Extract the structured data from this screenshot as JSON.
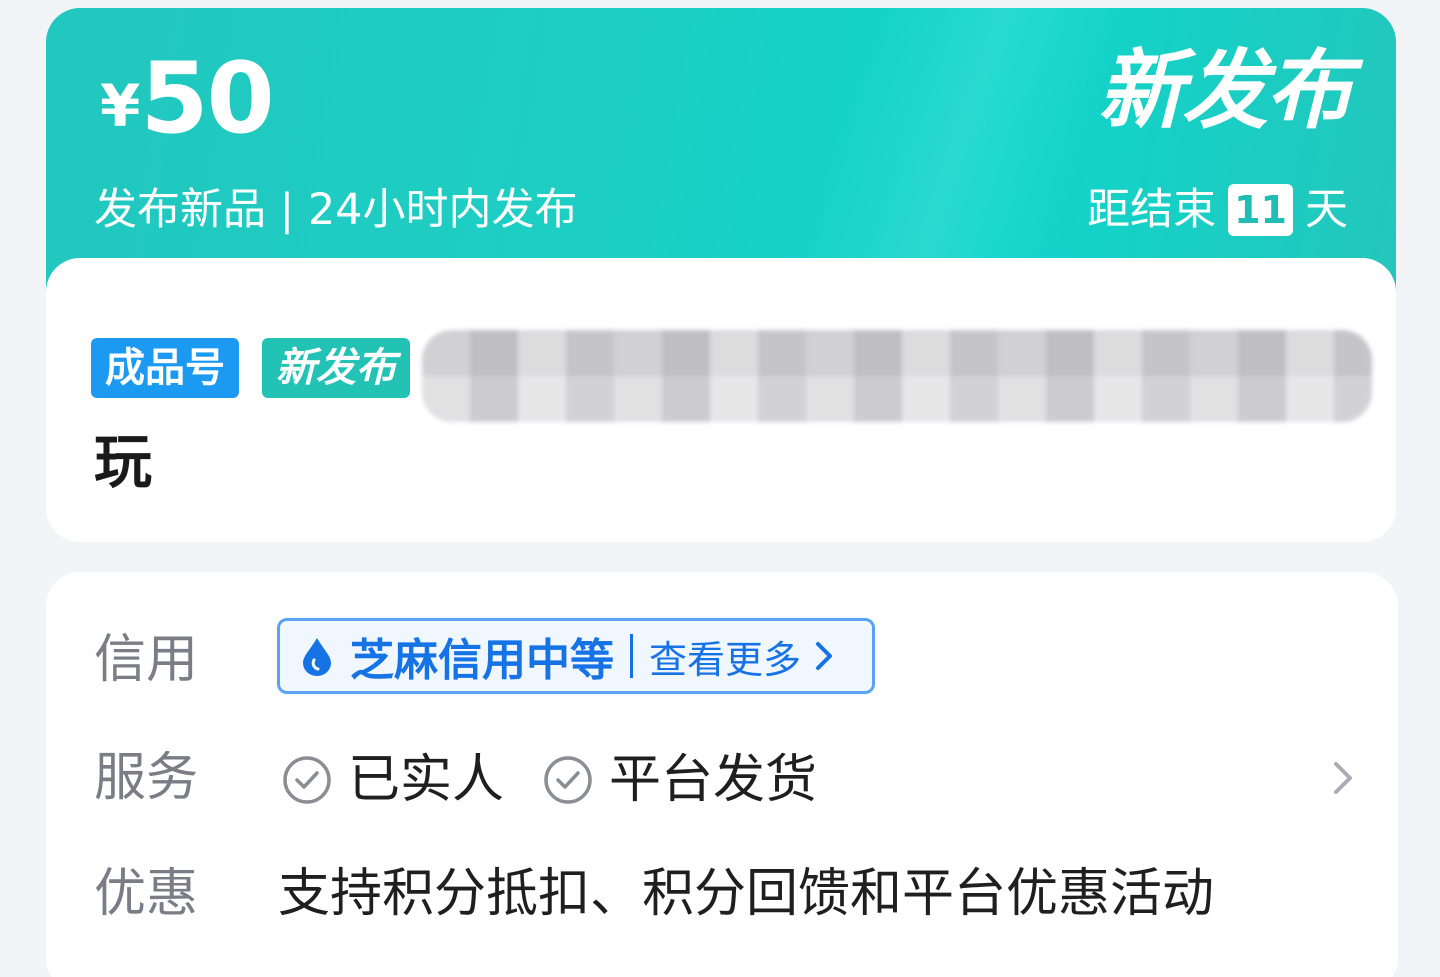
{
  "banner": {
    "currency": "¥",
    "price": "50",
    "subtitle": "发布新品 | 24小时内发布",
    "title": "新发布",
    "countdown_prefix": "距结束",
    "countdown_days": "11",
    "countdown_suffix": "天"
  },
  "product": {
    "tags": [
      "成品号",
      "新发布"
    ],
    "name_line2": "玩"
  },
  "info": {
    "credit": {
      "label": "信用",
      "chip_text": "芝麻信用中等",
      "more_text": "查看更多"
    },
    "service": {
      "label": "服务",
      "items": [
        "已实人",
        "平台发货"
      ]
    },
    "promo": {
      "label": "优惠",
      "text": "支持积分抵扣、积分回馈和平台优惠活动"
    }
  },
  "colors": {
    "banner_teal": "#1ccfc4",
    "tag_blue": "#1c9af2",
    "tag_teal": "#22c2b4",
    "credit_blue": "#1673e6"
  },
  "icons": {
    "credit": "drop-icon",
    "more": "chevron-right-icon",
    "service_check": "check-circle-icon",
    "service_arrow": "chevron-right-icon"
  }
}
